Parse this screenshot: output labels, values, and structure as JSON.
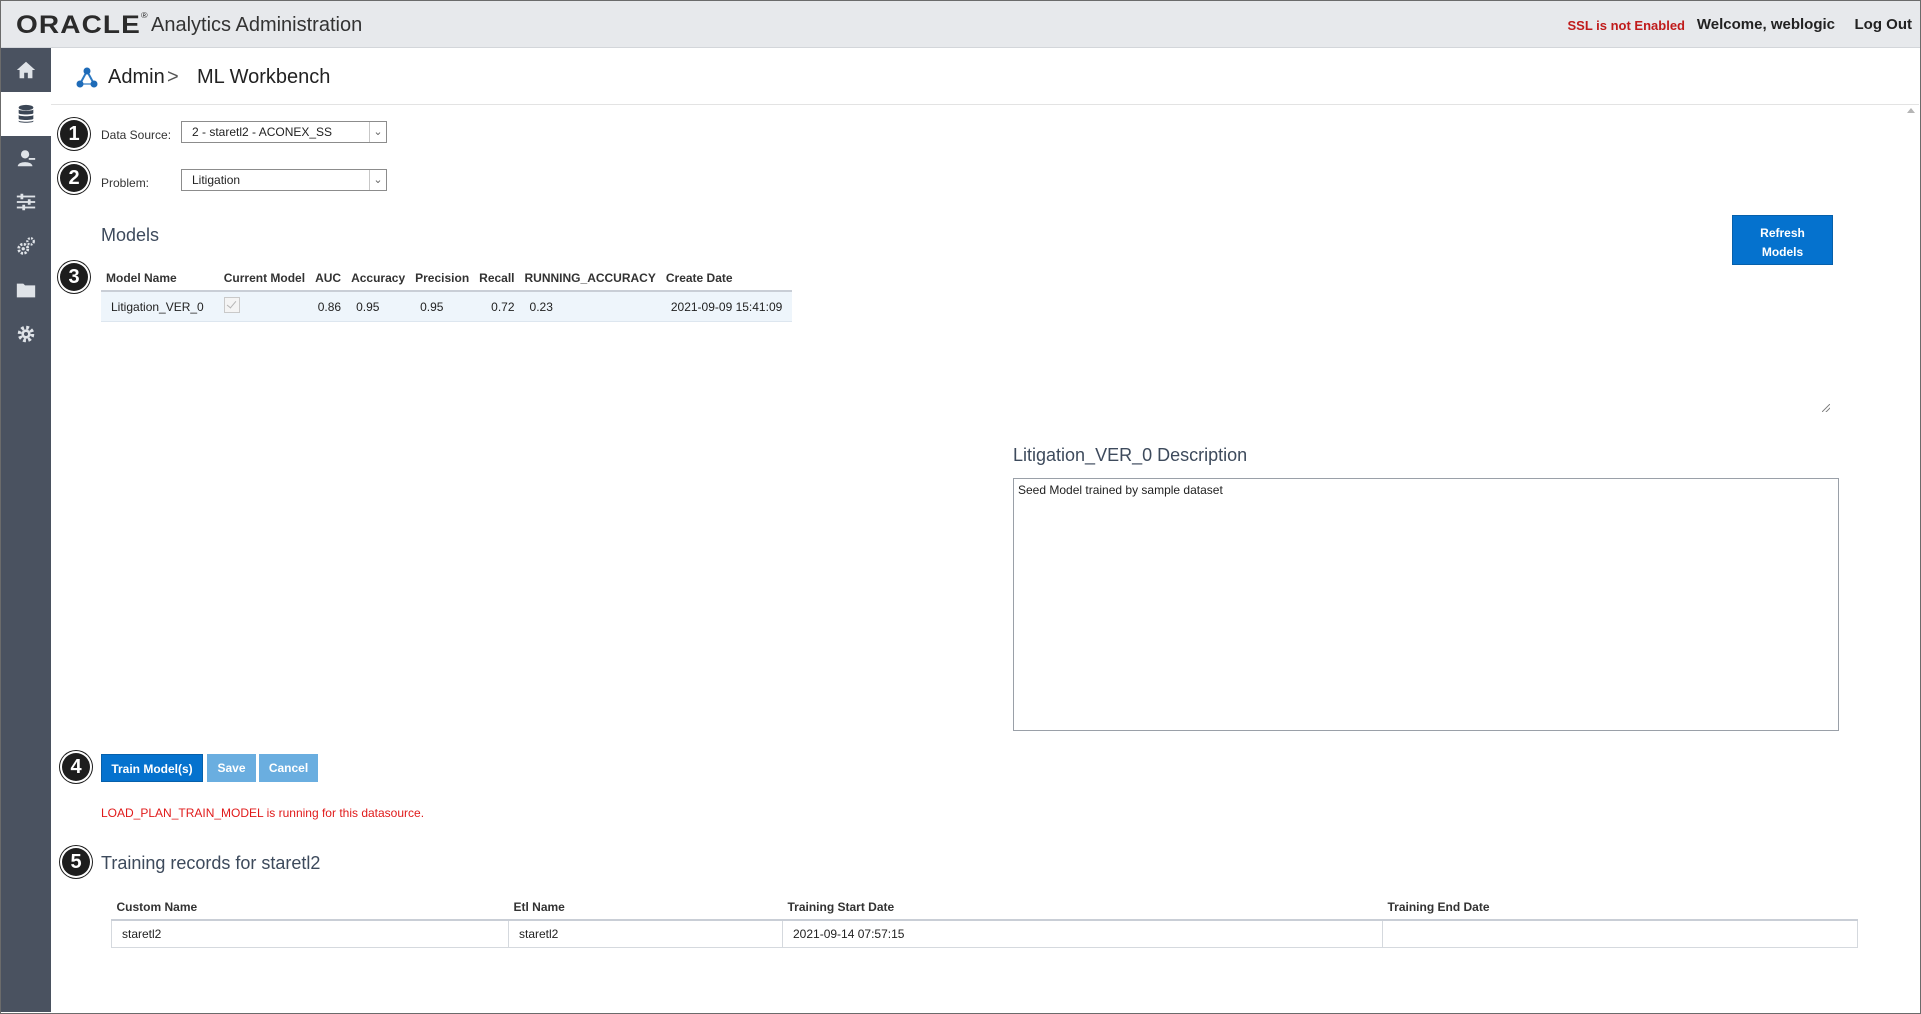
{
  "header": {
    "logo": "ORACLE",
    "app_title": "Analytics Administration",
    "ssl_status": "SSL is not Enabled",
    "welcome": "Welcome, weblogic",
    "logout": "Log Out"
  },
  "sidebar": {
    "items": [
      {
        "icon": "home-icon",
        "active": false
      },
      {
        "icon": "database-icon",
        "active": true
      },
      {
        "icon": "user-icon",
        "active": false
      },
      {
        "icon": "sliders-icon",
        "active": false
      },
      {
        "icon": "gears-icon",
        "active": false
      },
      {
        "icon": "folder-icon",
        "active": false
      },
      {
        "icon": "gear-icon",
        "active": false
      }
    ]
  },
  "breadcrumb": {
    "admin": "Admin",
    "separator": ">",
    "page": "ML Workbench"
  },
  "steps": [
    "1",
    "2",
    "3",
    "4",
    "5"
  ],
  "form": {
    "data_source_label": "Data Source:",
    "data_source_value": "2 - staretl2 - ACONEX_SS",
    "problem_label": "Problem:",
    "problem_value": "Litigation"
  },
  "models": {
    "title": "Models",
    "refresh_line1": "Refresh",
    "refresh_line2": "Models",
    "columns": [
      "Model Name",
      "Current Model",
      "AUC",
      "Accuracy",
      "Precision",
      "Recall",
      "RUNNING_ACCURACY",
      "Create Date"
    ],
    "rows": [
      {
        "name": "Litigation_VER_0",
        "current": true,
        "auc": "0.86",
        "accuracy": "0.95",
        "precision": "0.95",
        "recall": "0.72",
        "running_accuracy": "0.23",
        "create_date": "2021-09-09 15:41:09"
      }
    ]
  },
  "description": {
    "title": "Litigation_VER_0 Description",
    "text": "Seed Model trained by sample dataset"
  },
  "actions": {
    "train": "Train Model(s)",
    "save": "Save",
    "cancel": "Cancel"
  },
  "warning": "LOAD_PLAN_TRAIN_MODEL is running for this datasource.",
  "training": {
    "title": "Training records for staretl2",
    "columns": [
      "Custom Name",
      "Etl Name",
      "Training Start Date",
      "Training End Date"
    ],
    "rows": [
      {
        "custom_name": "staretl2",
        "etl_name": "staretl2",
        "start": "2021-09-14 07:57:15",
        "end": ""
      }
    ]
  },
  "colors": {
    "accent": "#0572ce",
    "accent_light": "#6aaee0",
    "sidebar": "#4a5260",
    "error": "#e01a1a"
  }
}
